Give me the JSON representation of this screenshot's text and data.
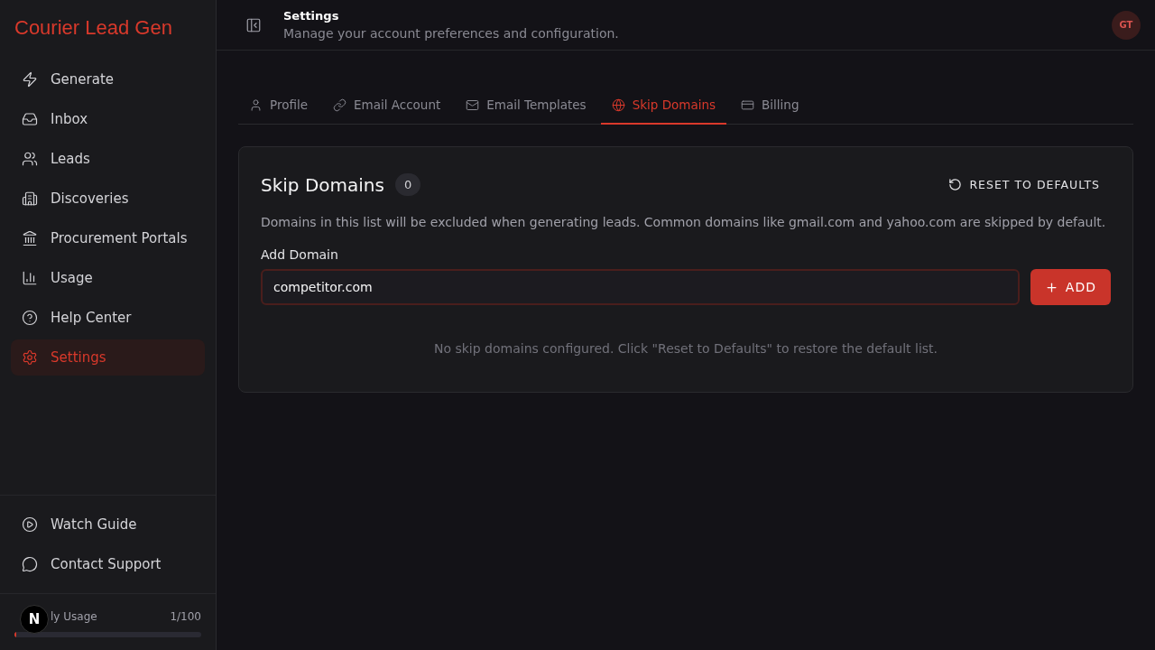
{
  "sidebar": {
    "brand": "Courier Lead Gen",
    "items": [
      {
        "label": "Generate",
        "kind": "zap",
        "selected": false
      },
      {
        "label": "Inbox",
        "kind": "inbox",
        "selected": false
      },
      {
        "label": "Leads",
        "kind": "users",
        "selected": false
      },
      {
        "label": "Discoveries",
        "kind": "building",
        "selected": false
      },
      {
        "label": "Procurement Portals",
        "kind": "landmark",
        "selected": false
      },
      {
        "label": "Usage",
        "kind": "chart",
        "selected": false
      },
      {
        "label": "Help Center",
        "kind": "help",
        "selected": false
      },
      {
        "label": "Settings",
        "kind": "settings",
        "selected": true
      }
    ],
    "footer_items": [
      {
        "label": "Watch Guide",
        "kind": "play"
      },
      {
        "label": "Contact Support",
        "kind": "message"
      }
    ],
    "usage": {
      "label": "ly Usage",
      "count": "1/100",
      "level": 0.01,
      "badge": "N"
    }
  },
  "header": {
    "title": "Settings",
    "subtitle": "Manage your account preferences and configuration.",
    "avatar": "GT"
  },
  "tabs": [
    {
      "label": "Profile",
      "kind": "user",
      "selected": false
    },
    {
      "label": "Email Account",
      "kind": "link",
      "selected": false
    },
    {
      "label": "Email Templates",
      "kind": "mail",
      "selected": false
    },
    {
      "label": "Skip Domains",
      "kind": "globe",
      "selected": true
    },
    {
      "label": "Billing",
      "kind": "card",
      "selected": false
    }
  ],
  "card": {
    "title": "Skip Domains",
    "count": "0",
    "reset_button": "RESET TO DEFAULTS",
    "description": "Domains in this list will be excluded when generating leads. Common domains like gmail.com and yahoo.com are skipped by default.",
    "field_label": "Add Domain",
    "field_value": "competitor.com",
    "add_button": "ADD",
    "empty_message": "No skip domains configured. Click \"Reset to Defaults\" to restore the default list."
  }
}
